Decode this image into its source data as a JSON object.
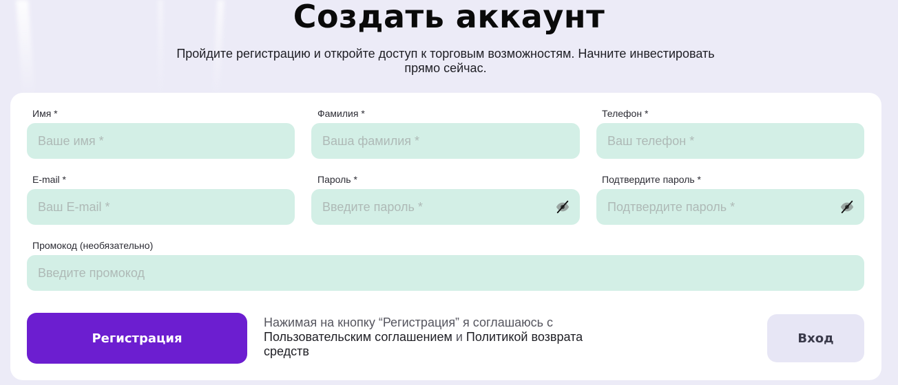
{
  "header": {
    "title": "Создать аккаунт",
    "subtitle": "Пройдите регистрацию и откройте доступ к торговым возможностям. Начните инвестировать прямо сейчас."
  },
  "form": {
    "first_name": {
      "label": "Имя *",
      "placeholder": "Ваше имя *",
      "value": ""
    },
    "last_name": {
      "label": "Фамилия *",
      "placeholder": "Ваша фамилия *",
      "value": ""
    },
    "phone": {
      "label": "Телефон *",
      "placeholder": "Ваш телефон *",
      "value": ""
    },
    "email": {
      "label": "E-mail *",
      "placeholder": "Ваш E-mail *",
      "value": ""
    },
    "password": {
      "label": "Пароль *",
      "placeholder": "Введите пароль *",
      "value": "",
      "toggle_icon": "eye-off-icon"
    },
    "confirm_password": {
      "label": "Подтвердите пароль *",
      "placeholder": "Подтвердите пароль *",
      "value": "",
      "toggle_icon": "eye-off-icon"
    },
    "promo": {
      "label": "Промокод (необязательно)",
      "placeholder": "Введите промокод",
      "value": ""
    }
  },
  "actions": {
    "register_label": "Регистрация",
    "login_label": "Вход",
    "agreement": {
      "prefix": "Нажимая на кнопку “Регистрация” я соглашаюсь с ",
      "terms_link": "Пользовательским соглашением",
      "conjunction": " и ",
      "refund_link": "Политикой возврата средств"
    }
  },
  "colors": {
    "background": "#ECEBF7",
    "card": "#FFFFFF",
    "field": "#D3EFE6",
    "primary": "#6C1ED0",
    "secondary_button": "#E7E6F5"
  }
}
